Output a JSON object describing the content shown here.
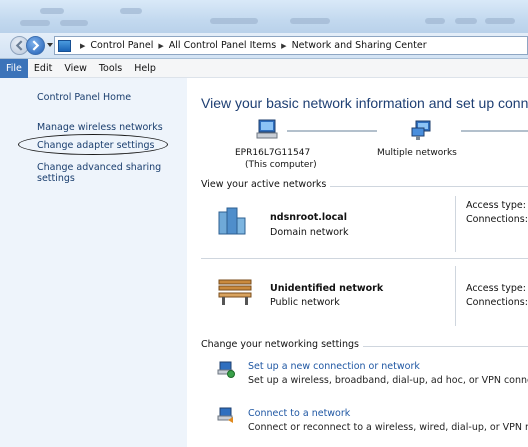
{
  "address_bar": {
    "crumbs": [
      "Control Panel",
      "All Control Panel Items",
      "Network and Sharing Center"
    ]
  },
  "menu": [
    "File",
    "Edit",
    "View",
    "Tools",
    "Help"
  ],
  "sidebar": {
    "home": "Control Panel Home",
    "links": [
      "Manage wireless networks",
      "Change adapter settings",
      "Change advanced sharing",
      "settings"
    ]
  },
  "main": {
    "title": "View your basic network information and set up connec",
    "map": {
      "computer_name": "EPR16L7G11547",
      "computer_sub": "(This computer)",
      "network_label": "Multiple networks"
    },
    "active_header": "View your active networks",
    "networks": [
      {
        "name": "ndsnroot.local",
        "type": "Domain network",
        "access": "Access type:",
        "connections": "Connections:"
      },
      {
        "name": "Unidentified network",
        "type": "Public network",
        "access": "Access type:",
        "connections": "Connections:"
      }
    ],
    "settings_header": "Change your networking settings",
    "tasks": [
      {
        "link": "Set up a new connection or network",
        "desc": "Set up a wireless, broadband, dial-up, ad hoc, or VPN connectio"
      },
      {
        "link": "Connect to a network",
        "desc": "Connect or reconnect to a wireless, wired, dial-up, or VPN netw"
      }
    ]
  }
}
